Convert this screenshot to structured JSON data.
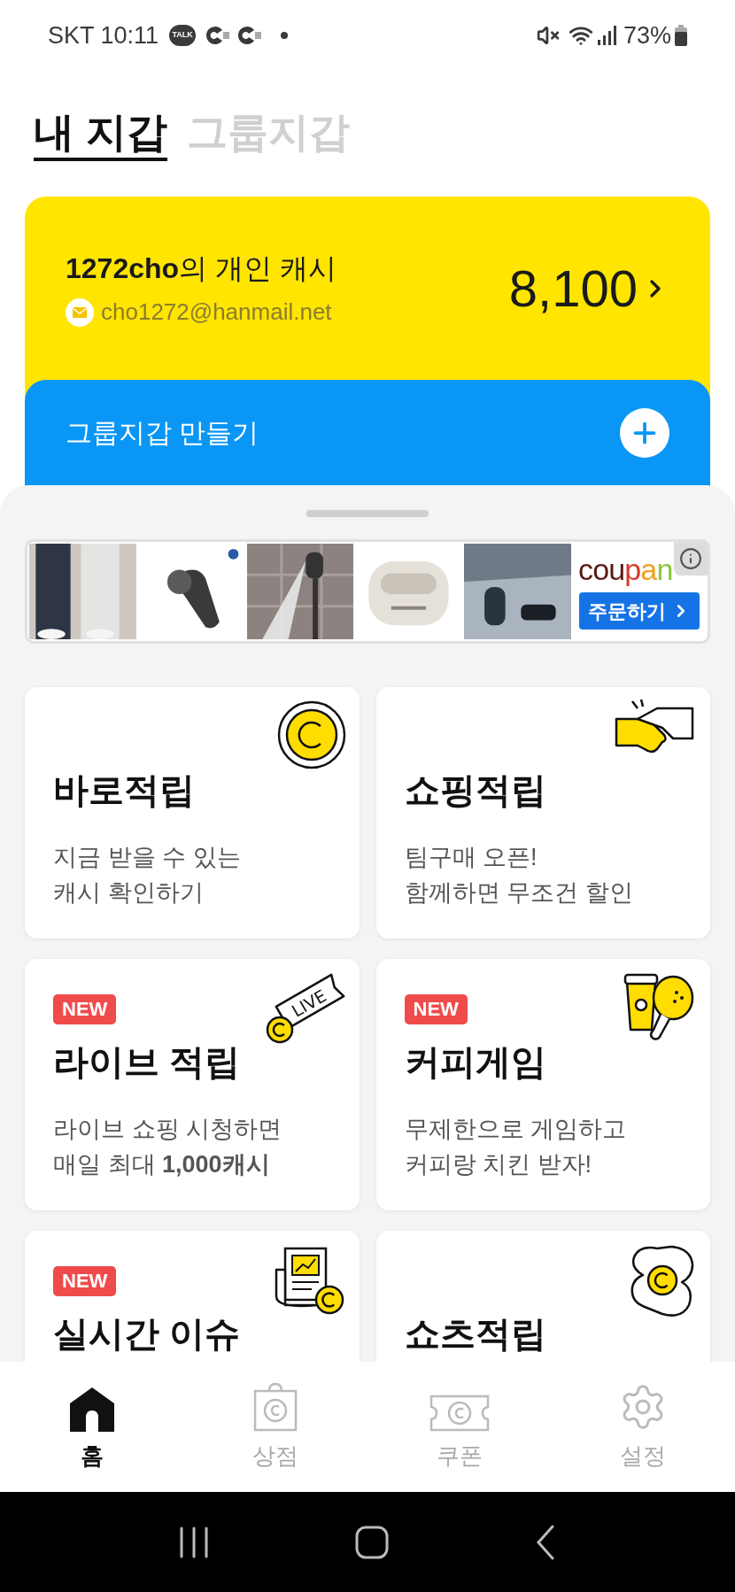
{
  "status_bar": {
    "carrier_time": "SKT 10:11",
    "notification_badge": "TALK",
    "battery": "73%"
  },
  "tabs": [
    {
      "label": "내 지갑",
      "selected": true
    },
    {
      "label": "그룹지갑",
      "selected": false
    }
  ],
  "wallet_card": {
    "owner": "**1272cho**의 개인 캐시",
    "email": "cho1272@hanmail.net",
    "amount": "8,100"
  },
  "group_card": {
    "label": "그룹지갑 만들기"
  },
  "ad_banner": {
    "brand": "coupan",
    "button": "주문하기"
  },
  "tiles": [
    {
      "kind": "coin",
      "title": "바로적립",
      "description": [
        "지금 받을 수 있는",
        "캐시 확인하기"
      ]
    },
    {
      "kind": "handshake",
      "title": "쇼핑적립",
      "description": [
        "팀구매 오픈!",
        "함께하면 무조건 할인"
      ]
    },
    {
      "kind": "live",
      "icon_text": "LIVE",
      "badge": "NEW",
      "title": "라이브 적립",
      "description": [
        "라이브 쇼핑 시청하면",
        "매일 최대 **1,000캐시**"
      ]
    },
    {
      "kind": "coffee-chicken",
      "badge": "NEW",
      "title": "커피게임",
      "description": [
        "무제한으로 게임하고",
        "커피랑 치킨 받자!"
      ]
    },
    {
      "kind": "news",
      "badge": "NEW",
      "title": "실시간 이슈"
    },
    {
      "kind": "shorts",
      "title": "쇼츠적립"
    }
  ],
  "bottom_nav": [
    {
      "kind": "home",
      "label": "홈",
      "selected": true
    },
    {
      "kind": "shop",
      "label": "상점",
      "selected": false
    },
    {
      "kind": "coupon",
      "label": "쿠폰",
      "selected": false
    },
    {
      "kind": "settings",
      "label": "설정",
      "selected": false
    }
  ]
}
